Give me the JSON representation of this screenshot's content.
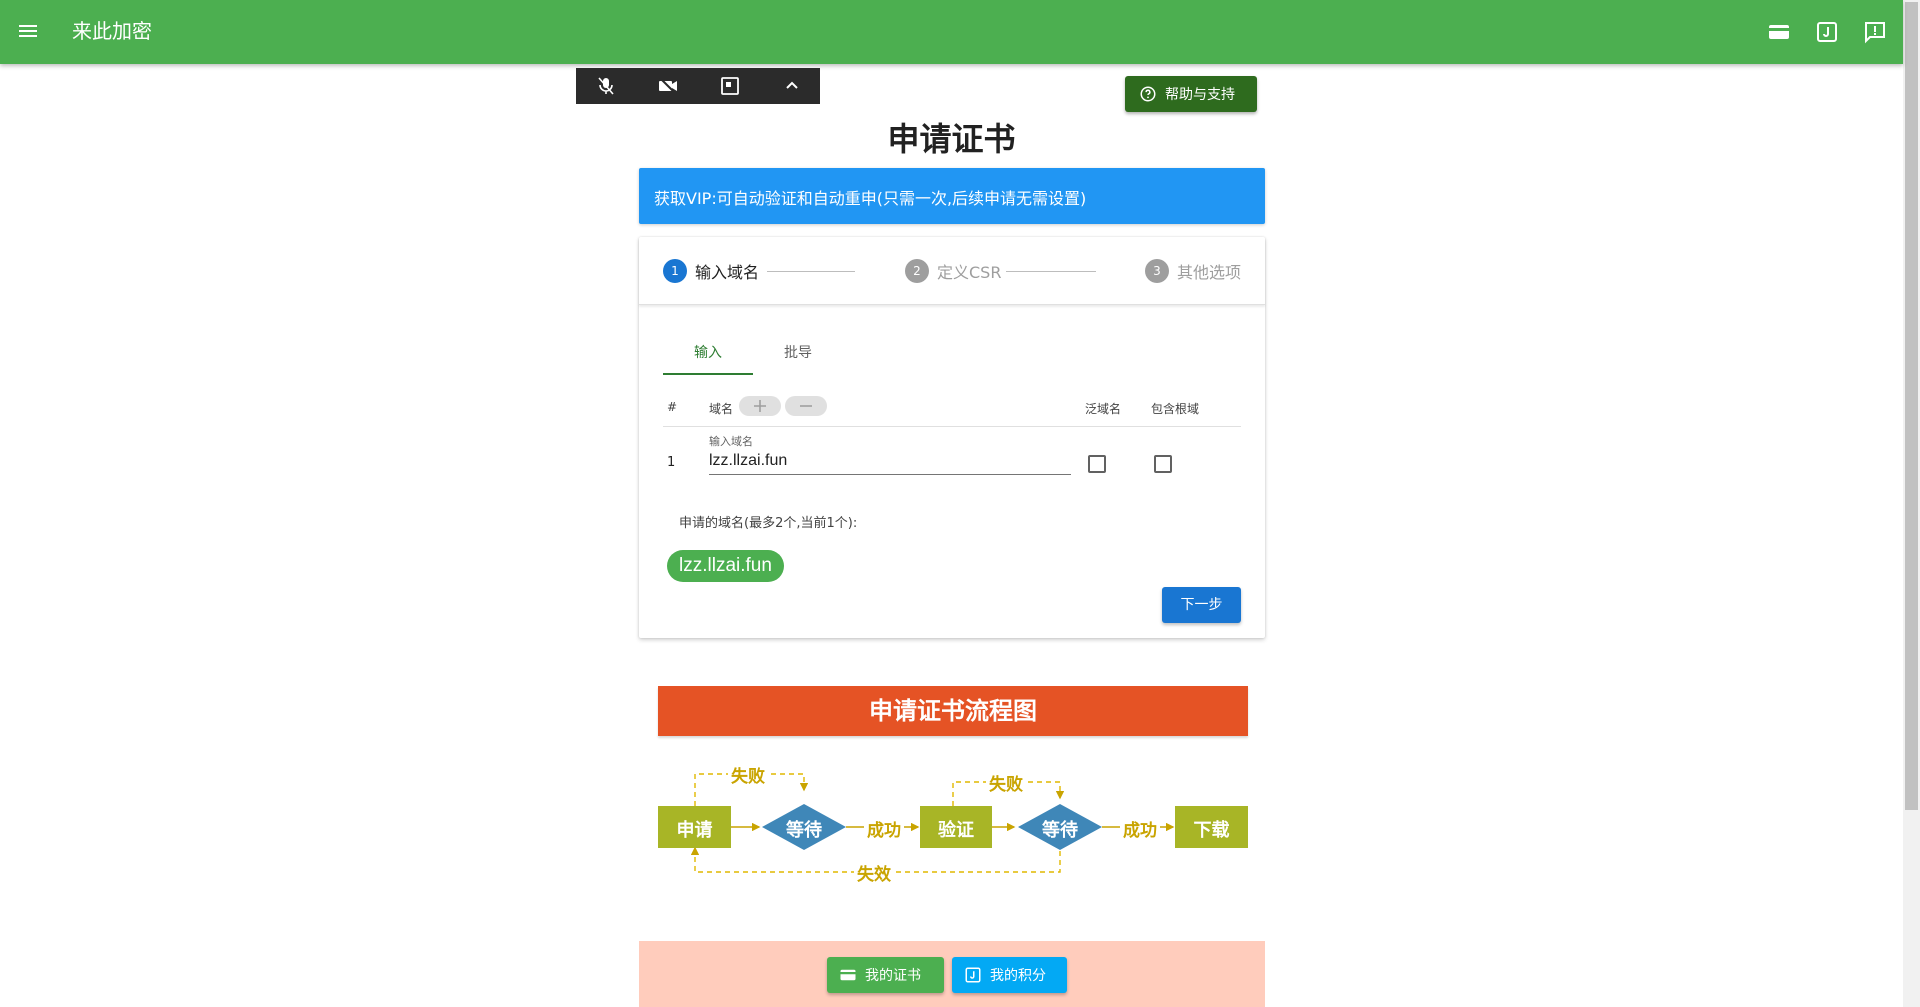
{
  "appbar": {
    "title": "来此加密"
  },
  "help": {
    "label": "帮助与支持"
  },
  "page": {
    "title": "申请证书"
  },
  "vip_banner": "获取VIP:可自动验证和自动重申(只需一次,后续申请无需设置)",
  "stepper": {
    "steps": [
      {
        "num": "1",
        "label": "输入域名"
      },
      {
        "num": "2",
        "label": "定义CSR"
      },
      {
        "num": "3",
        "label": "其他选项"
      }
    ]
  },
  "tabs": [
    {
      "label": "输入"
    },
    {
      "label": "批导"
    }
  ],
  "table": {
    "headers": {
      "index": "#",
      "domain": "域名",
      "wildcard": "泛域名",
      "include_root": "包含根域"
    },
    "rows": [
      {
        "index": "1",
        "field_label": "输入域名",
        "value": "lzz.llzai.fun"
      }
    ]
  },
  "applied": {
    "label": "申请的域名(最多2个,当前1个):",
    "chips": [
      "lzz.llzai.fun"
    ]
  },
  "next_label": "下一步",
  "flowchart": {
    "title": "申请证书流程图",
    "nodes": {
      "apply": "申请",
      "wait1": "等待",
      "verify": "验证",
      "wait2": "等待",
      "download": "下载"
    },
    "edges": {
      "success1": "成功",
      "success2": "成功",
      "fail1": "失败",
      "fail2": "失败",
      "expire": "失效"
    },
    "colors": {
      "box": "#a8b526",
      "diamond": "#3f87b8",
      "text": "#c9a400",
      "banner": "#e55325"
    }
  },
  "bottom": {
    "my_certs": "我的证书",
    "my_points": "我的积分"
  },
  "colors": {
    "primary": "#4caf50",
    "blue": "#1976d2",
    "vip": "#2196f3",
    "pink": "#ffccbc",
    "help": "#2e6b1e",
    "points": "#03a9f4"
  }
}
